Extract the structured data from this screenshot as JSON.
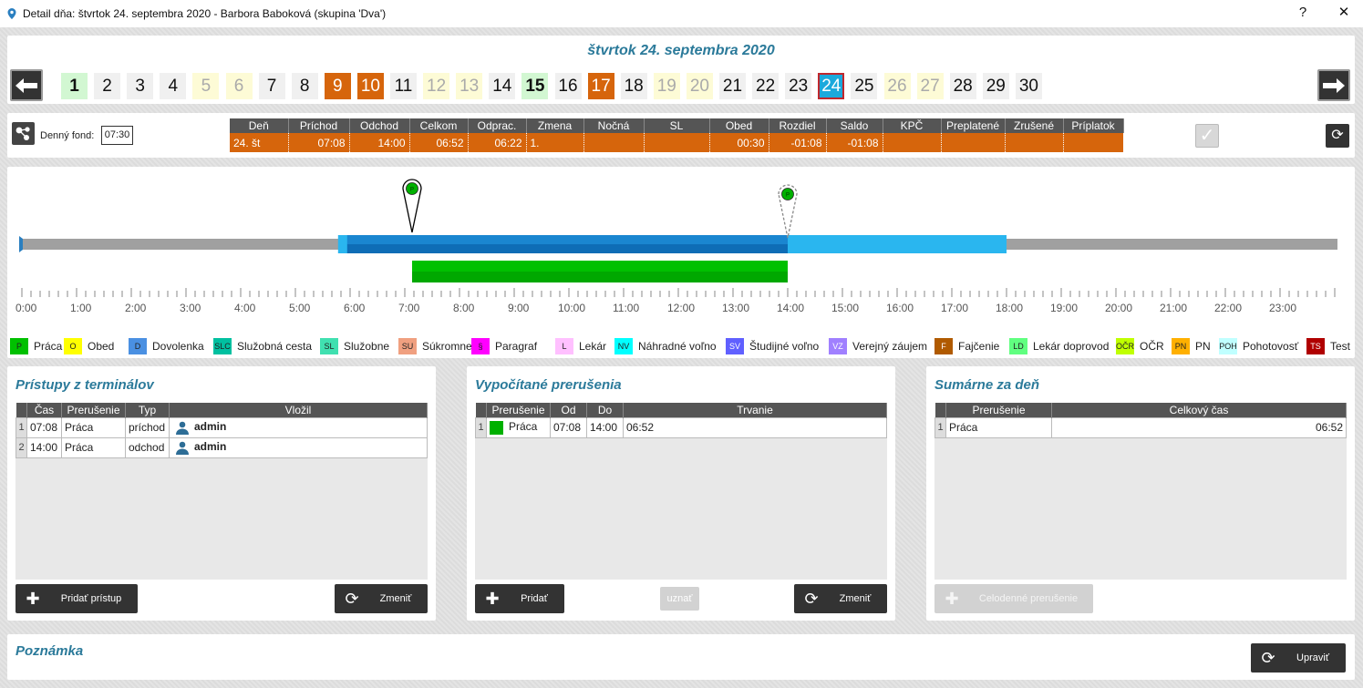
{
  "window": {
    "title": "Detail dňa: štvrtok 24. septembra 2020 -  Barbora Baboková  (skupina 'Dva')",
    "help": "?",
    "close": "✕"
  },
  "day_nav": {
    "date_title": "štvrtok 24. septembra 2020",
    "days": [
      {
        "n": "1",
        "kind": "work"
      },
      {
        "n": "2",
        "kind": "normal"
      },
      {
        "n": "3",
        "kind": "normal"
      },
      {
        "n": "4",
        "kind": "normal"
      },
      {
        "n": "5",
        "kind": "free"
      },
      {
        "n": "6",
        "kind": "free"
      },
      {
        "n": "7",
        "kind": "normal"
      },
      {
        "n": "8",
        "kind": "normal"
      },
      {
        "n": "9",
        "kind": "holiday"
      },
      {
        "n": "10",
        "kind": "holiday"
      },
      {
        "n": "11",
        "kind": "normal"
      },
      {
        "n": "12",
        "kind": "free"
      },
      {
        "n": "13",
        "kind": "free"
      },
      {
        "n": "14",
        "kind": "normal"
      },
      {
        "n": "15",
        "kind": "work"
      },
      {
        "n": "16",
        "kind": "normal"
      },
      {
        "n": "17",
        "kind": "holiday"
      },
      {
        "n": "18",
        "kind": "normal"
      },
      {
        "n": "19",
        "kind": "free"
      },
      {
        "n": "20",
        "kind": "free"
      },
      {
        "n": "21",
        "kind": "normal"
      },
      {
        "n": "22",
        "kind": "normal"
      },
      {
        "n": "23",
        "kind": "normal"
      },
      {
        "n": "24",
        "kind": "sel"
      },
      {
        "n": "25",
        "kind": "normal"
      },
      {
        "n": "26",
        "kind": "free"
      },
      {
        "n": "27",
        "kind": "free"
      },
      {
        "n": "28",
        "kind": "normal"
      },
      {
        "n": "29",
        "kind": "normal"
      },
      {
        "n": "30",
        "kind": "normal"
      }
    ]
  },
  "fund": {
    "label": "Denný fond:",
    "value": "07:30",
    "headers": [
      "Deň",
      "Príchod",
      "Odchod",
      "Celkom",
      "Odprac.",
      "Zmena",
      "Nočná",
      "SL",
      "Obed",
      "Rozdiel",
      "Saldo",
      "KPČ",
      "Preplatené",
      "Zrušené",
      "Príplatok"
    ],
    "row": [
      "24. št",
      "07:08",
      "14:00",
      "06:52",
      "06:22",
      "1.",
      "",
      "",
      "00:30",
      "-01:08",
      "-01:08",
      "",
      "",
      "",
      ""
    ],
    "check": "✓",
    "refresh": "⟳"
  },
  "timeline": {
    "hours": [
      "0:00",
      "1:00",
      "2:00",
      "3:00",
      "4:00",
      "5:00",
      "6:00",
      "7:00",
      "8:00",
      "9:00",
      "10:00",
      "11:00",
      "12:00",
      "13:00",
      "14:00",
      "15:00",
      "16:00",
      "17:00",
      "18:00",
      "19:00",
      "20:00",
      "21:00",
      "22:00",
      "23:00"
    ],
    "shift_start_h": 5.78,
    "shift_end_h": 18.0,
    "work_start_h": 7.133,
    "work_end_h": 14.0,
    "pin_marks": [
      "P",
      "P"
    ]
  },
  "legend": [
    {
      "code": "P",
      "label": "Práca",
      "color": "#00c000"
    },
    {
      "code": "O",
      "label": "Obed",
      "color": "#ffff00"
    },
    {
      "code": "D",
      "label": "Dovolenka",
      "color": "#4a90e2"
    },
    {
      "code": "SLC",
      "label": "Služobná cesta",
      "color": "#00c0a0"
    },
    {
      "code": "SL",
      "label": "Služobne",
      "color": "#40e0b0"
    },
    {
      "code": "SU",
      "label": "Súkromne",
      "color": "#f0a080"
    },
    {
      "code": "§",
      "label": "Paragraf",
      "color": "#ff00ff"
    },
    {
      "code": "L",
      "label": "Lekár",
      "color": "#ffc0ff"
    },
    {
      "code": "NV",
      "label": "Náhradné voľno",
      "color": "#00ffff"
    },
    {
      "code": "SV",
      "label": "Študijné voľno",
      "color": "#6060ff"
    },
    {
      "code": "VZ",
      "label": "Verejný záujem",
      "color": "#a080ff"
    },
    {
      "code": "F",
      "label": "Fajčenie",
      "color": "#b05a00"
    },
    {
      "code": "LD",
      "label": "Lekár doprovod",
      "color": "#60ff80"
    },
    {
      "code": "OČR",
      "label": "OČR",
      "color": "#c0ff00"
    },
    {
      "code": "PN",
      "label": "PN",
      "color": "#ffb000"
    },
    {
      "code": "POH",
      "label": "Pohotovosť",
      "color": "#c0ffff"
    },
    {
      "code": "TS",
      "label": "Test",
      "color": "#b00000"
    }
  ],
  "pristupy": {
    "title": "Prístupy z terminálov",
    "headers": [
      "Čas",
      "Prerušenie",
      "Typ",
      "Vložil"
    ],
    "rows": [
      {
        "n": "1",
        "cas": "07:08",
        "prerusenie": "Práca",
        "typ": "príchod",
        "vlozil": "admin"
      },
      {
        "n": "2",
        "cas": "14:00",
        "prerusenie": "Práca",
        "typ": "odchod",
        "vlozil": "admin"
      }
    ],
    "add_label": "Pridať prístup",
    "change_label": "Zmeniť"
  },
  "vypocitane": {
    "title": "Vypočítané prerušenia",
    "headers": [
      "Prerušenie",
      "Od",
      "Do",
      "Trvanie"
    ],
    "rows": [
      {
        "n": "1",
        "prerusenie": "Práca",
        "od": "07:08",
        "do": "14:00",
        "trvanie": "06:52",
        "color": "#00b000"
      }
    ],
    "add_label": "Pridať",
    "uznat_label": "uznať",
    "change_label": "Zmeniť"
  },
  "sumarne": {
    "title": "Sumárne za deň",
    "headers": [
      "Prerušenie",
      "Celkový čas"
    ],
    "rows": [
      {
        "n": "1",
        "prerusenie": "Práca",
        "cas": "06:52"
      }
    ],
    "celodenne_label": "Celodenné prerušenie"
  },
  "poznamka": {
    "title": "Poznámka",
    "upravit_label": "Upraviť"
  }
}
